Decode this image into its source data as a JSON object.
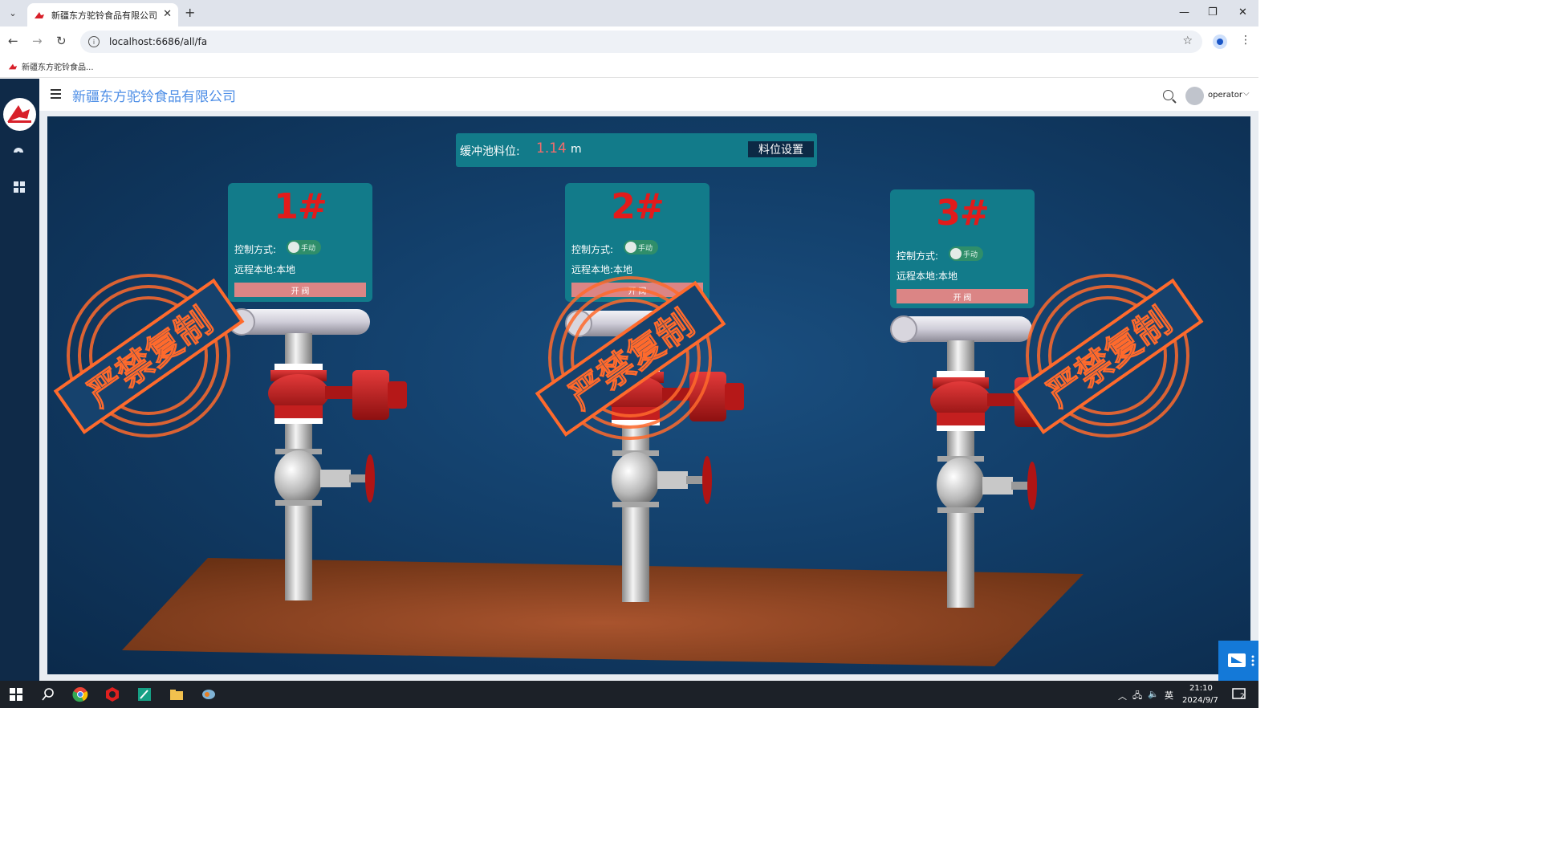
{
  "browser": {
    "tab_title": "新疆东方驼铃食品有限公司",
    "url": "localhost:6686/all/fa",
    "bookmark_label": "新疆东方驼铃食品..."
  },
  "header": {
    "company_name": "新疆东方驼铃食品有限公司",
    "username": "operator"
  },
  "buffer": {
    "label": "缓冲池料位:",
    "value": "1.14",
    "unit": "m",
    "settings_button": "料位设置"
  },
  "valves": [
    {
      "title": "1#",
      "control_label": "控制方式:",
      "control_mode": "手动",
      "remote_label": "远程本地:",
      "remote_value": "本地",
      "action_button": "开 阀"
    },
    {
      "title": "2#",
      "control_label": "控制方式:",
      "control_mode": "手动",
      "remote_label": "远程本地:",
      "remote_value": "本地",
      "action_button": "开 阀"
    },
    {
      "title": "3#",
      "control_label": "控制方式:",
      "control_mode": "手动",
      "remote_label": "远程本地:",
      "remote_value": "本地",
      "action_button": "开 阀"
    }
  ],
  "watermark": "严禁复制",
  "taskbar": {
    "time": "21:10",
    "date": "2024/9/7",
    "ime": "英",
    "notification_count": "2"
  },
  "colors": {
    "accent": "#4d8ee6",
    "panel": "#127b8a",
    "title_red": "#e21b1b",
    "stamp": "#ff6a2c"
  }
}
